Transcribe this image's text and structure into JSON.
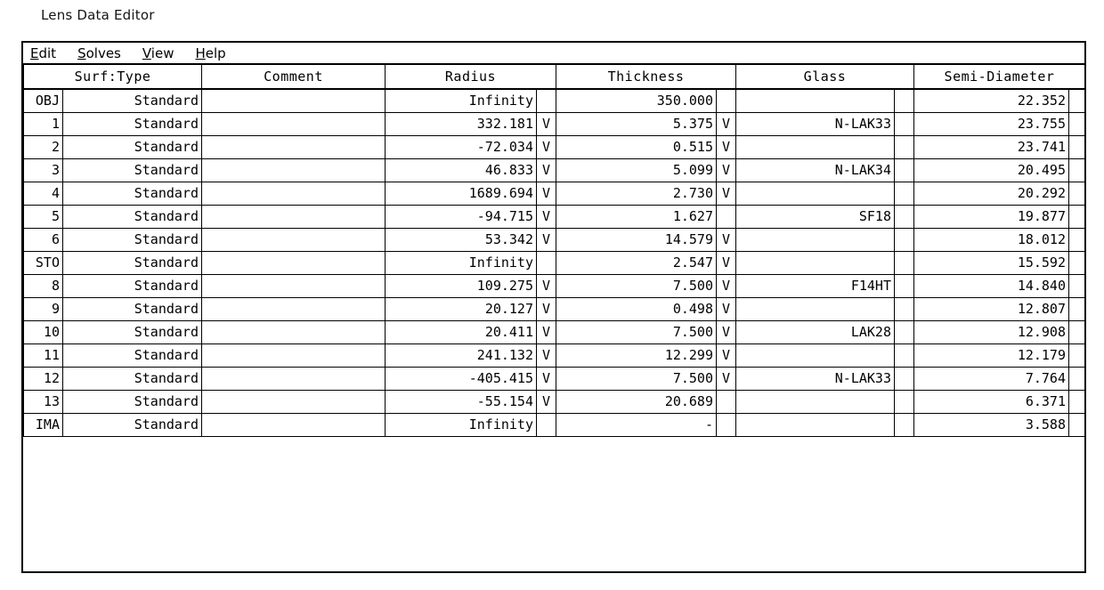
{
  "window": {
    "title": "Lens Data Editor"
  },
  "menu": {
    "items": [
      {
        "accel": "E",
        "rest": "dit"
      },
      {
        "accel": "S",
        "rest": "olves"
      },
      {
        "accel": "V",
        "rest": "iew"
      },
      {
        "accel": "H",
        "rest": "elp"
      }
    ]
  },
  "table": {
    "headers": {
      "surf_type": "Surf:Type",
      "comment": "Comment",
      "radius": "Radius",
      "thickness": "Thickness",
      "glass": "Glass",
      "semi_diameter": "Semi-Diameter"
    },
    "solve_marker": "V",
    "rows": [
      {
        "surf": "OBJ",
        "type": "Standard",
        "comment": "",
        "comment_selected": true,
        "radius": "Infinity",
        "radius_solve": "",
        "thickness": "350.000",
        "thickness_solve": "",
        "glass": "",
        "glass_solve": "",
        "semi": "22.352",
        "semi_solve": ""
      },
      {
        "surf": "1",
        "type": "Standard",
        "comment": "",
        "comment_selected": false,
        "radius": "332.181",
        "radius_solve": "V",
        "thickness": "5.375",
        "thickness_solve": "V",
        "glass": "N-LAK33",
        "glass_solve": "",
        "semi": "23.755",
        "semi_solve": ""
      },
      {
        "surf": "2",
        "type": "Standard",
        "comment": "",
        "comment_selected": false,
        "radius": "-72.034",
        "radius_solve": "V",
        "thickness": "0.515",
        "thickness_solve": "V",
        "glass": "",
        "glass_solve": "",
        "semi": "23.741",
        "semi_solve": ""
      },
      {
        "surf": "3",
        "type": "Standard",
        "comment": "",
        "comment_selected": false,
        "radius": "46.833",
        "radius_solve": "V",
        "thickness": "5.099",
        "thickness_solve": "V",
        "glass": "N-LAK34",
        "glass_solve": "",
        "semi": "20.495",
        "semi_solve": ""
      },
      {
        "surf": "4",
        "type": "Standard",
        "comment": "",
        "comment_selected": false,
        "radius": "1689.694",
        "radius_solve": "V",
        "thickness": "2.730",
        "thickness_solve": "V",
        "glass": "",
        "glass_solve": "",
        "semi": "20.292",
        "semi_solve": ""
      },
      {
        "surf": "5",
        "type": "Standard",
        "comment": "",
        "comment_selected": false,
        "radius": "-94.715",
        "radius_solve": "V",
        "thickness": "1.627",
        "thickness_solve": "",
        "glass": "SF18",
        "glass_solve": "",
        "semi": "19.877",
        "semi_solve": ""
      },
      {
        "surf": "6",
        "type": "Standard",
        "comment": "",
        "comment_selected": false,
        "radius": "53.342",
        "radius_solve": "V",
        "thickness": "14.579",
        "thickness_solve": "V",
        "glass": "",
        "glass_solve": "",
        "semi": "18.012",
        "semi_solve": ""
      },
      {
        "surf": "STO",
        "type": "Standard",
        "comment": "",
        "comment_selected": false,
        "radius": "Infinity",
        "radius_solve": "",
        "thickness": "2.547",
        "thickness_solve": "V",
        "glass": "",
        "glass_solve": "",
        "semi": "15.592",
        "semi_solve": ""
      },
      {
        "surf": "8",
        "type": "Standard",
        "comment": "",
        "comment_selected": false,
        "radius": "109.275",
        "radius_solve": "V",
        "thickness": "7.500",
        "thickness_solve": "V",
        "glass": "F14HT",
        "glass_solve": "",
        "semi": "14.840",
        "semi_solve": ""
      },
      {
        "surf": "9",
        "type": "Standard",
        "comment": "",
        "comment_selected": false,
        "radius": "20.127",
        "radius_solve": "V",
        "thickness": "0.498",
        "thickness_solve": "V",
        "glass": "",
        "glass_solve": "",
        "semi": "12.807",
        "semi_solve": ""
      },
      {
        "surf": "10",
        "type": "Standard",
        "comment": "",
        "comment_selected": false,
        "radius": "20.411",
        "radius_solve": "V",
        "thickness": "7.500",
        "thickness_solve": "V",
        "glass": "LAK28",
        "glass_solve": "",
        "semi": "12.908",
        "semi_solve": ""
      },
      {
        "surf": "11",
        "type": "Standard",
        "comment": "",
        "comment_selected": false,
        "radius": "241.132",
        "radius_solve": "V",
        "thickness": "12.299",
        "thickness_solve": "V",
        "glass": "",
        "glass_solve": "",
        "semi": "12.179",
        "semi_solve": ""
      },
      {
        "surf": "12",
        "type": "Standard",
        "comment": "",
        "comment_selected": false,
        "radius": "-405.415",
        "radius_solve": "V",
        "thickness": "7.500",
        "thickness_solve": "V",
        "glass": "N-LAK33",
        "glass_solve": "",
        "semi": "7.764",
        "semi_solve": ""
      },
      {
        "surf": "13",
        "type": "Standard",
        "comment": "",
        "comment_selected": false,
        "radius": "-55.154",
        "radius_solve": "V",
        "thickness": "20.689",
        "thickness_solve": "",
        "glass": "",
        "glass_solve": "",
        "semi": "6.371",
        "semi_solve": ""
      },
      {
        "surf": "IMA",
        "type": "Standard",
        "comment": "",
        "comment_selected": false,
        "radius": "Infinity",
        "radius_solve": "",
        "thickness": "-",
        "thickness_solve": "",
        "glass": "",
        "glass_solve": "",
        "semi": "3.588",
        "semi_solve": ""
      }
    ]
  }
}
